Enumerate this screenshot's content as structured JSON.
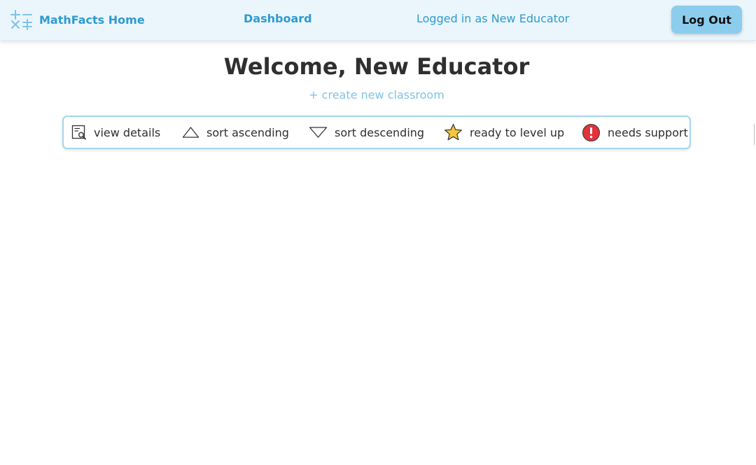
{
  "header": {
    "brand_label": "MathFacts Home",
    "brand_icon": "math-operators-icon",
    "dashboard_label": "Dashboard",
    "logged_in_text": "Logged in as New Educator",
    "logout_label": "Log Out"
  },
  "main": {
    "welcome_title": "Welcome, New Educator",
    "create_classroom_label": "+ create new classroom"
  },
  "legend": {
    "items": [
      {
        "icon": "view-details-icon",
        "label": "view details"
      },
      {
        "icon": "sort-ascending-icon",
        "label": "sort ascending"
      },
      {
        "icon": "sort-descending-icon",
        "label": "sort descending"
      },
      {
        "icon": "star-icon",
        "label": "ready to level up"
      },
      {
        "icon": "alert-icon",
        "label": "needs support"
      }
    ]
  },
  "colors": {
    "accent": "#2e9bd0",
    "header_bg": "#eaf6fc",
    "button_bg": "#8ccdee",
    "link_light": "#7fc3e6",
    "star": "#f5c53a",
    "alert": "#e0333c"
  }
}
